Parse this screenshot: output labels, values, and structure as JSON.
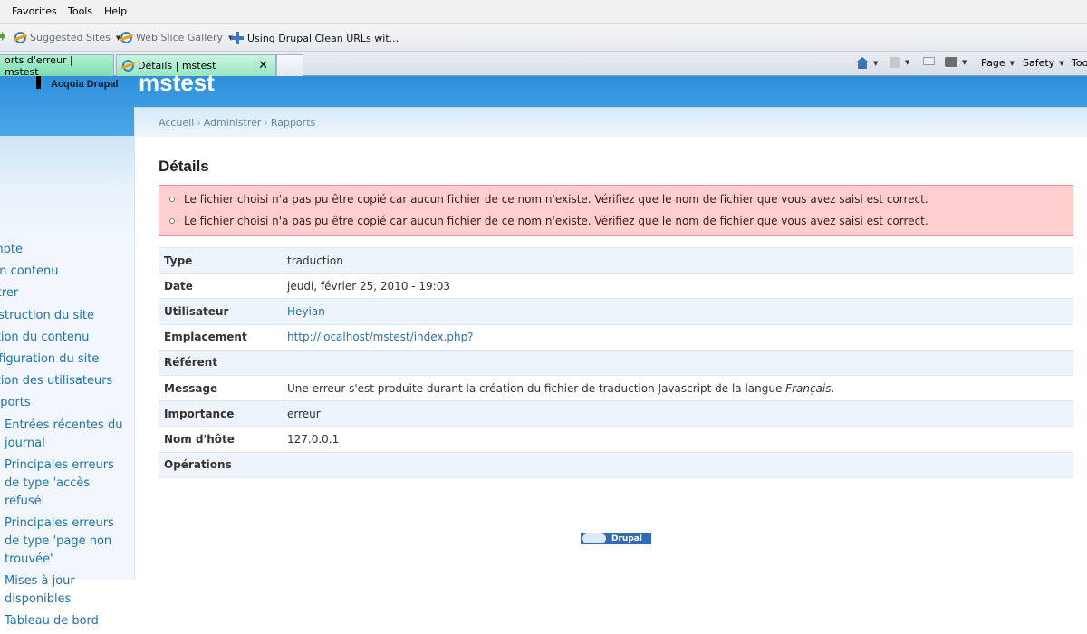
{
  "menubar": {
    "items": [
      {
        "label": "Favorites"
      },
      {
        "label": "Tools"
      },
      {
        "label": "Help"
      }
    ]
  },
  "favorites_bar": {
    "items": [
      {
        "label": "Suggested Sites"
      },
      {
        "label": "Web Slice Gallery"
      },
      {
        "label": "Using Drupal Clean URLs wit..."
      }
    ]
  },
  "tabs": [
    {
      "label": "orts d'erreur | mstest"
    },
    {
      "label": "Détails | mstest",
      "active": true
    }
  ],
  "command_bar": {
    "page": "Page",
    "safety": "Safety",
    "tools": "Too"
  },
  "site": {
    "logo_text": "Acquia Drupal",
    "name": "mstest"
  },
  "breadcrumb": [
    "Accueil",
    "Administrer",
    "Rapports"
  ],
  "nav": {
    "top": [
      "mpte",
      "un contenu",
      "strer",
      "nstruction du site",
      "stion du contenu",
      "nfiguration du site",
      "stion des utilisateurs",
      "pports"
    ],
    "sub": [
      "Entrées récentes du journal",
      "Principales erreurs de type 'accès refusé'",
      "Principales erreurs de type 'page non trouvée'",
      "Mises à jour disponibles",
      "Tableau de bord"
    ]
  },
  "page_title": "Détails",
  "messages": [
    "Le fichier choisi n'a pas pu être copié car aucun fichier de ce nom n'existe. Vérifiez que le nom de fichier que vous avez saisi est correct.",
    "Le fichier choisi n'a pas pu être copié car aucun fichier de ce nom n'existe. Vérifiez que le nom de fichier que vous avez saisi est correct."
  ],
  "details": {
    "type_label": "Type",
    "type_value": "traduction",
    "date_label": "Date",
    "date_value": "jeudi, février 25, 2010 - 19:03",
    "user_label": "Utilisateur",
    "user_value": "Heyian",
    "location_label": "Emplacement",
    "location_value": "http://localhost/mstest/index.php?",
    "referrer_label": "Référent",
    "referrer_value": "",
    "message_label": "Message",
    "message_value": "Une erreur s'est produite durant la création du fichier de traduction Javascript de la langue",
    "message_lang": "Français",
    "message_end": ".",
    "severity_label": "Importance",
    "severity_value": "erreur",
    "host_label": "Nom d'hôte",
    "host_value": "127.0.0.1",
    "operations_label": "Opérations",
    "operations_value": ""
  },
  "footer": {
    "badge": "Drupal"
  }
}
